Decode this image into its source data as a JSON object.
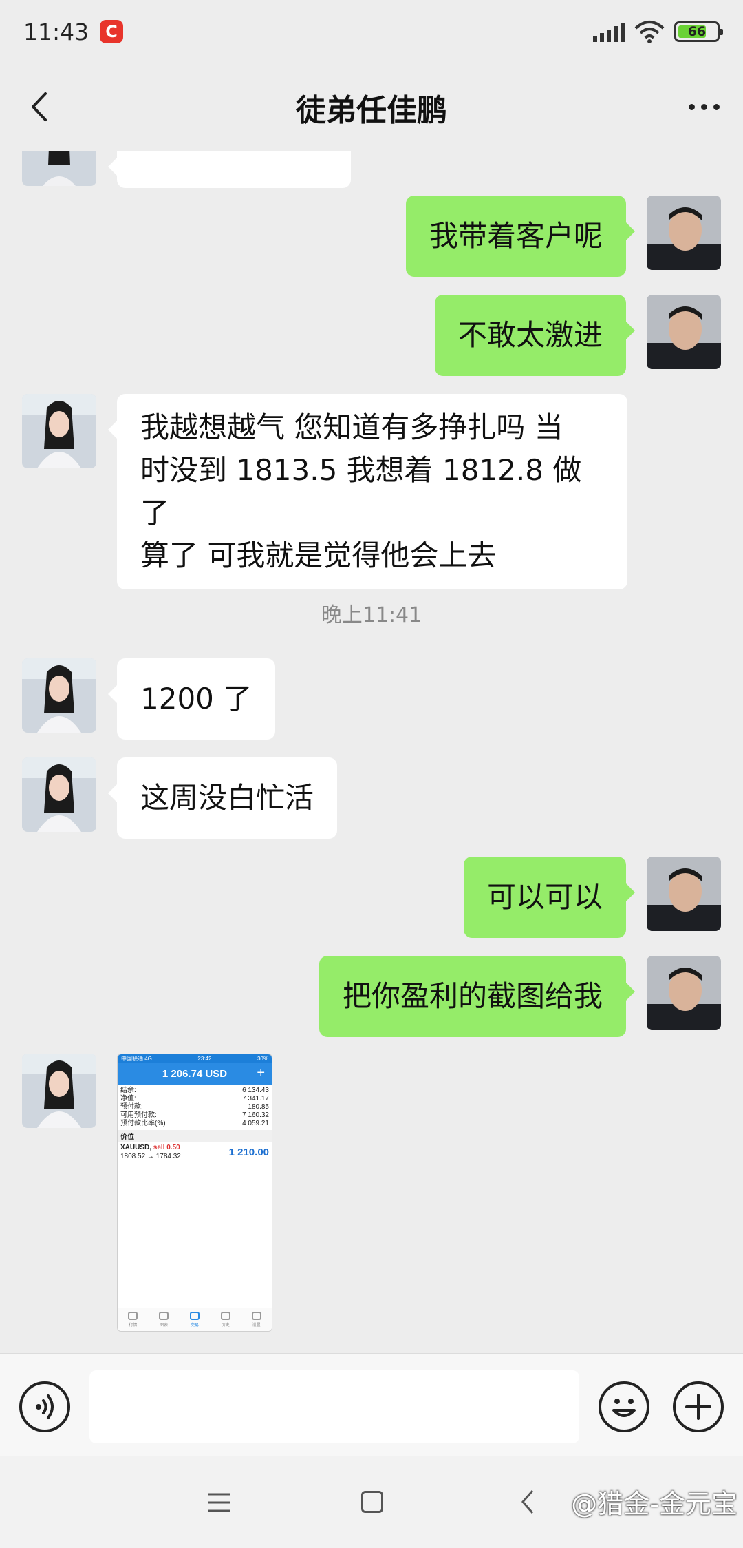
{
  "status_bar": {
    "time": "11:43",
    "app_badge": "C",
    "battery": "66"
  },
  "header": {
    "title": "徒弟任佳鹏"
  },
  "messages": {
    "m1": "我带着客户呢",
    "m2": "不敢太激进",
    "m3_line1": "我越想越气 您知道有多挣扎吗 当",
    "m3_line2": "时没到 1813.5 我想着 1812.8 做了",
    "m3_line3": "算了 可我就是觉得他会上去",
    "timestamp": "晚上11:41",
    "m4": "1200 了",
    "m5": "这周没白忙活",
    "m6": "可以可以",
    "m7": "把你盈利的截图给我"
  },
  "image_message": {
    "status_left": "中国联通 4G",
    "status_time": "23:42",
    "status_right": "30%",
    "balance_header": "1 206.74 USD",
    "rows": [
      {
        "label": "结余:",
        "value": "6 134.43"
      },
      {
        "label": "净值:",
        "value": "7 341.17"
      },
      {
        "label": "预付款:",
        "value": "180.85"
      },
      {
        "label": "可用预付款:",
        "value": "7 160.32"
      },
      {
        "label": "预付款比率(%)",
        "value": "4 059.21"
      }
    ],
    "section": "价位",
    "symbol": "XAUUSD,",
    "order": "sell 0.50",
    "prices": "1808.52 → 1784.32",
    "profit": "1 210.00",
    "tabs": [
      "行情",
      "图表",
      "交易",
      "历史",
      "设置"
    ]
  },
  "input_bar": {
    "placeholder": ""
  },
  "watermark": "@猎金-金元宝",
  "colors": {
    "outgoing_bubble": "#95ec69",
    "incoming_bubble": "#ffffff",
    "background": "#ededed"
  }
}
